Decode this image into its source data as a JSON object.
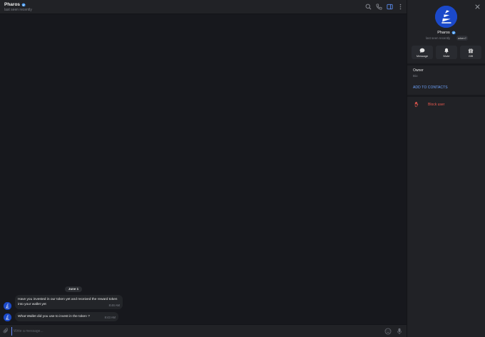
{
  "header": {
    "title": "Pharos",
    "status": "last seen recently"
  },
  "messages": {
    "date": "June 1",
    "items": [
      {
        "text": "Have you invested in our token yet and received the reward token into your wallet yet",
        "time": "8:46 AM"
      },
      {
        "text": "What Wallet did you use to invest in the token ?",
        "time": "8:43 AM"
      }
    ]
  },
  "composer": {
    "placeholder": "Write a message..."
  },
  "profile": {
    "name": "Pharos",
    "status": "last seen recently",
    "when_badge": "when?",
    "actions": [
      {
        "label": "Message",
        "icon": "chat-bubble-icon"
      },
      {
        "label": "Mute",
        "icon": "bell-icon"
      },
      {
        "label": "Gift",
        "icon": "gift-icon"
      }
    ],
    "owner_label": "Owner",
    "bio_label": "Bio",
    "add_contacts": "ADD TO CONTACTS",
    "block_user": "Block user"
  },
  "colors": {
    "accent": "#6ea4ff",
    "avatar_bg": "#1b49c9",
    "danger": "#e8594f",
    "chat_bg": "#17181d",
    "panel_bg": "#212226"
  }
}
